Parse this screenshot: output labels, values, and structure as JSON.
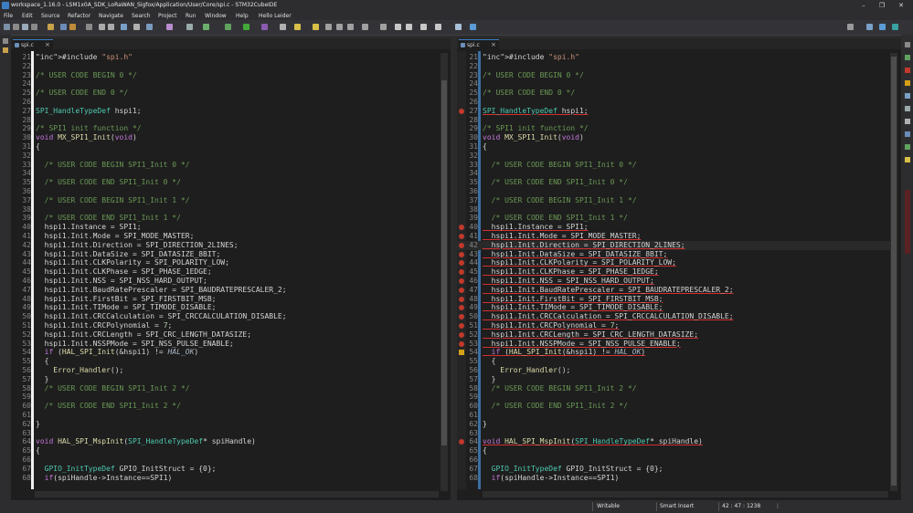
{
  "window": {
    "title": "workspace_1.16.0 - LSM1x0A_SDK_LoRaWAN_Sigfox/Application/User/Core/spi.c - STM32CubeIDE",
    "minimize": "–",
    "maximize": "❐",
    "close": "✕"
  },
  "menu": [
    "File",
    "Edit",
    "Source",
    "Refactor",
    "Navigate",
    "Search",
    "Project",
    "Run",
    "Window",
    "Help",
    "Hello Leider"
  ],
  "left_editor": {
    "tab_label": "spi.c",
    "lines": [
      {
        "n": "21",
        "t": "#include \"spi.h\""
      },
      {
        "n": "22",
        "t": ""
      },
      {
        "n": "23",
        "t": "/* USER CODE BEGIN 0 */"
      },
      {
        "n": "24",
        "t": ""
      },
      {
        "n": "25",
        "t": "/* USER CODE END 0 */"
      },
      {
        "n": "26",
        "t": ""
      },
      {
        "n": "27",
        "t": "SPI_HandleTypeDef hspi1;"
      },
      {
        "n": "28",
        "t": ""
      },
      {
        "n": "29",
        "t": "/* SPI1 init function */"
      },
      {
        "n": "30",
        "t": "void MX_SPI1_Init(void)"
      },
      {
        "n": "31",
        "t": "{"
      },
      {
        "n": "32",
        "t": ""
      },
      {
        "n": "33",
        "t": "  /* USER CODE BEGIN SPI1_Init 0 */"
      },
      {
        "n": "34",
        "t": ""
      },
      {
        "n": "35",
        "t": "  /* USER CODE END SPI1_Init 0 */"
      },
      {
        "n": "36",
        "t": ""
      },
      {
        "n": "37",
        "t": "  /* USER CODE BEGIN SPI1_Init 1 */"
      },
      {
        "n": "38",
        "t": ""
      },
      {
        "n": "39",
        "t": "  /* USER CODE END SPI1_Init 1 */"
      },
      {
        "n": "40",
        "t": "  hspi1.Instance = SPI1;"
      },
      {
        "n": "41",
        "t": "  hspi1.Init.Mode = SPI_MODE_MASTER;"
      },
      {
        "n": "42",
        "t": "  hspi1.Init.Direction = SPI_DIRECTION_2LINES;"
      },
      {
        "n": "43",
        "t": "  hspi1.Init.DataSize = SPI_DATASIZE_8BIT;"
      },
      {
        "n": "44",
        "t": "  hspi1.Init.CLKPolarity = SPI_POLARITY_LOW;"
      },
      {
        "n": "45",
        "t": "  hspi1.Init.CLKPhase = SPI_PHASE_1EDGE;"
      },
      {
        "n": "46",
        "t": "  hspi1.Init.NSS = SPI_NSS_HARD_OUTPUT;"
      },
      {
        "n": "47",
        "t": "  hspi1.Init.BaudRatePrescaler = SPI_BAUDRATEPRESCALER_2;"
      },
      {
        "n": "48",
        "t": "  hspi1.Init.FirstBit = SPI_FIRSTBIT_MSB;"
      },
      {
        "n": "49",
        "t": "  hspi1.Init.TIMode = SPI_TIMODE_DISABLE;"
      },
      {
        "n": "50",
        "t": "  hspi1.Init.CRCCalculation = SPI_CRCCALCULATION_DISABLE;"
      },
      {
        "n": "51",
        "t": "  hspi1.Init.CRCPolynomial = 7;"
      },
      {
        "n": "52",
        "t": "  hspi1.Init.CRCLength = SPI_CRC_LENGTH_DATASIZE;"
      },
      {
        "n": "53",
        "t": "  hspi1.Init.NSSPMode = SPI_NSS_PULSE_ENABLE;"
      },
      {
        "n": "54",
        "t": "  if (HAL_SPI_Init(&hspi1) != HAL_OK)"
      },
      {
        "n": "55",
        "t": "  {"
      },
      {
        "n": "56",
        "t": "    Error_Handler();"
      },
      {
        "n": "57",
        "t": "  }"
      },
      {
        "n": "58",
        "t": "  /* USER CODE BEGIN SPI1_Init 2 */"
      },
      {
        "n": "59",
        "t": ""
      },
      {
        "n": "60",
        "t": "  /* USER CODE END SPI1_Init 2 */"
      },
      {
        "n": "61",
        "t": ""
      },
      {
        "n": "62",
        "t": "}"
      },
      {
        "n": "63",
        "t": ""
      },
      {
        "n": "64",
        "t": "void HAL_SPI_MspInit(SPI_HandleTypeDef* spiHandle)"
      },
      {
        "n": "65",
        "t": "{"
      },
      {
        "n": "66",
        "t": ""
      },
      {
        "n": "67",
        "t": "  GPIO_InitTypeDef GPIO_InitStruct = {0};"
      },
      {
        "n": "68",
        "t": "  if(spiHandle->Instance==SPI1)"
      }
    ]
  },
  "right_editor": {
    "tab_label": "spi.c",
    "lines": [
      {
        "n": "21",
        "t": "#include \"spi.h\""
      },
      {
        "n": "22",
        "t": ""
      },
      {
        "n": "23",
        "t": "/* USER CODE BEGIN 0 */"
      },
      {
        "n": "24",
        "t": ""
      },
      {
        "n": "25",
        "t": "/* USER CODE END 0 */"
      },
      {
        "n": "26",
        "t": ""
      },
      {
        "n": "27",
        "t": "SPI_HandleTypeDef hspi1;"
      },
      {
        "n": "28",
        "t": ""
      },
      {
        "n": "29",
        "t": "/* SPI1 init function */"
      },
      {
        "n": "30",
        "t": "void MX_SPI1_Init(void)"
      },
      {
        "n": "31",
        "t": "{"
      },
      {
        "n": "32",
        "t": ""
      },
      {
        "n": "33",
        "t": "  /* USER CODE BEGIN SPI1_Init 0 */"
      },
      {
        "n": "34",
        "t": ""
      },
      {
        "n": "35",
        "t": "  /* USER CODE END SPI1_Init 0 */"
      },
      {
        "n": "36",
        "t": ""
      },
      {
        "n": "37",
        "t": "  /* USER CODE BEGIN SPI1_Init 1 */"
      },
      {
        "n": "38",
        "t": ""
      },
      {
        "n": "39",
        "t": "  /* USER CODE END SPI1_Init 1 */"
      },
      {
        "n": "40",
        "t": "  hspi1.Instance = SPI1;"
      },
      {
        "n": "41",
        "t": "  hspi1.Init.Mode = SPI_MODE_MASTER;"
      },
      {
        "n": "42",
        "t": "  hspi1.Init.Direction = SPI_DIRECTION_2LINES;"
      },
      {
        "n": "43",
        "t": "  hspi1.Init.DataSize = SPI_DATASIZE_8BIT;"
      },
      {
        "n": "44",
        "t": "  hspi1.Init.CLKPolarity = SPI_POLARITY_LOW;"
      },
      {
        "n": "45",
        "t": "  hspi1.Init.CLKPhase = SPI_PHASE_1EDGE;"
      },
      {
        "n": "46",
        "t": "  hspi1.Init.NSS = SPI_NSS_HARD_OUTPUT;"
      },
      {
        "n": "47",
        "t": "  hspi1.Init.BaudRatePrescaler = SPI_BAUDRATEPRESCALER_2;"
      },
      {
        "n": "48",
        "t": "  hspi1.Init.FirstBit = SPI_FIRSTBIT_MSB;"
      },
      {
        "n": "49",
        "t": "  hspi1.Init.TIMode = SPI_TIMODE_DISABLE;"
      },
      {
        "n": "50",
        "t": "  hspi1.Init.CRCCalculation = SPI_CRCCALCULATION_DISABLE;"
      },
      {
        "n": "51",
        "t": "  hspi1.Init.CRCPolynomial = 7;"
      },
      {
        "n": "52",
        "t": "  hspi1.Init.CRCLength = SPI_CRC_LENGTH_DATASIZE;"
      },
      {
        "n": "53",
        "t": "  hspi1.Init.NSSPMode = SPI_NSS_PULSE_ENABLE;"
      },
      {
        "n": "54",
        "t": "  if (HAL_SPI_Init(&hspi1) != HAL_OK)"
      },
      {
        "n": "55",
        "t": "  {"
      },
      {
        "n": "56",
        "t": "    Error_Handler();"
      },
      {
        "n": "57",
        "t": "  }"
      },
      {
        "n": "58",
        "t": "  /* USER CODE BEGIN SPI1_Init 2 */"
      },
      {
        "n": "59",
        "t": ""
      },
      {
        "n": "60",
        "t": "  /* USER CODE END SPI1_Init 2 */"
      },
      {
        "n": "61",
        "t": ""
      },
      {
        "n": "62",
        "t": "}"
      },
      {
        "n": "63",
        "t": ""
      },
      {
        "n": "64",
        "t": "void HAL_SPI_MspInit(SPI_HandleTypeDef* spiHandle)"
      },
      {
        "n": "65",
        "t": "{"
      },
      {
        "n": "66",
        "t": ""
      },
      {
        "n": "67",
        "t": "  GPIO_InitTypeDef GPIO_InitStruct = {0};"
      },
      {
        "n": "68",
        "t": "  if(spiHandle->Instance==SPI1)"
      }
    ],
    "error_lines": [
      "27",
      "40",
      "41",
      "42",
      "43",
      "44",
      "45",
      "46",
      "47",
      "48",
      "49",
      "50",
      "51",
      "52",
      "53",
      "64"
    ],
    "warning_lines": [
      "54"
    ],
    "current_line": "42"
  },
  "status": {
    "writable": "Writable",
    "insert_mode": "Smart Insert",
    "position": "42 : 47 : 1238"
  },
  "colors": {
    "accent": "#3c7fc1",
    "error": "#c0392b",
    "warning": "#d4a017",
    "editor_bg": "#1e1e1e"
  }
}
